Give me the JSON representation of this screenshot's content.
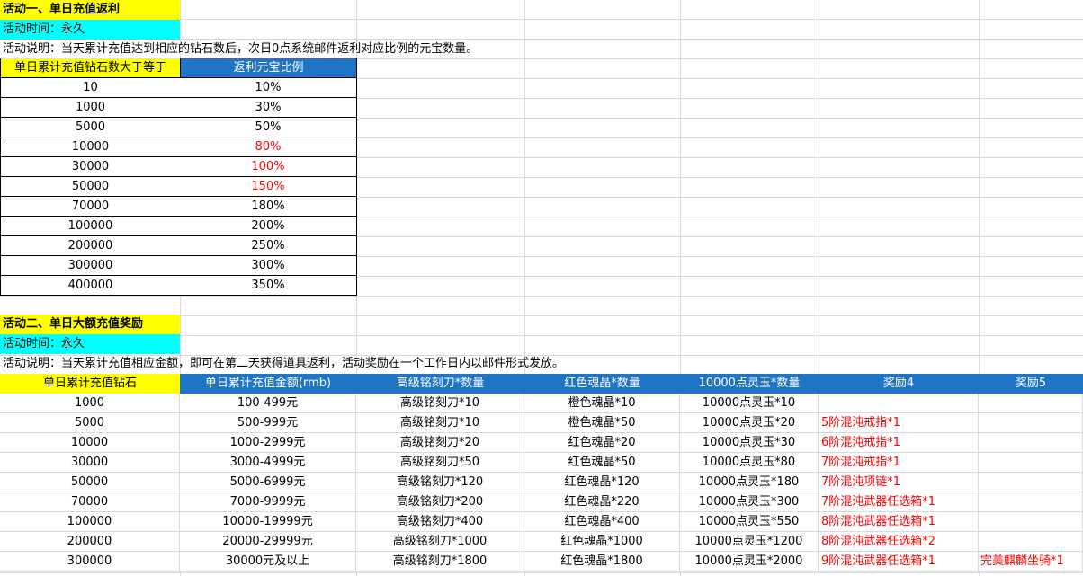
{
  "colors": {
    "title_bg": "#ffff00",
    "time_bg": "#00ffff",
    "header_bg": "#1f74c6",
    "accent_red": "#ff0000"
  },
  "activity1": {
    "title": "活动一、单日充值返利",
    "time": "活动时间：永久",
    "desc": "活动说明：当天累计充值达到相应的钻石数后，次日0点系统邮件返利对应比例的元宝数量。",
    "headers": [
      "单日累计充值钻石数大于等于",
      "返利元宝比例"
    ],
    "rows": [
      {
        "c0": "10",
        "c1": "10%"
      },
      {
        "c0": "1000",
        "c1": "30%"
      },
      {
        "c0": "5000",
        "c1": "50%"
      },
      {
        "c0": "10000",
        "c1": "80%"
      },
      {
        "c0": "30000",
        "c1": "100%"
      },
      {
        "c0": "50000",
        "c1": "150%"
      },
      {
        "c0": "70000",
        "c1": "180%"
      },
      {
        "c0": "100000",
        "c1": "200%"
      },
      {
        "c0": "200000",
        "c1": "250%"
      },
      {
        "c0": "300000",
        "c1": "300%"
      },
      {
        "c0": "400000",
        "c1": "350%"
      }
    ]
  },
  "activity2": {
    "title": "活动二、单日大额充值奖励",
    "time": "活动时间：永久",
    "desc": "活动说明：当天累计充值相应金额，即可在第二天获得道具返利，活动奖励在一个工作日内以邮件形式发放。",
    "headers": [
      "单日累计充值钻石",
      "单日累计充值金额(rmb)",
      "高级铭刻刀*数量",
      "红色魂晶*数量",
      "10000点灵玉*数量",
      "奖励4",
      "奖励5"
    ],
    "rows": [
      {
        "c0": "1000",
        "c1": "100-499元",
        "c2": "高级铭刻刀*10",
        "c3": "橙色魂晶*10",
        "c4": "10000点灵玉*10",
        "c5": "",
        "c6": ""
      },
      {
        "c0": "5000",
        "c1": "500-999元",
        "c2": "高级铭刻刀*10",
        "c3": "橙色魂晶*50",
        "c4": "10000点灵玉*20",
        "c5": "5阶混沌戒指*1",
        "c6": ""
      },
      {
        "c0": "10000",
        "c1": "1000-2999元",
        "c2": "高级铭刻刀*20",
        "c3": "红色魂晶*20",
        "c4": "10000点灵玉*30",
        "c5": "6阶混沌戒指*1",
        "c6": ""
      },
      {
        "c0": "30000",
        "c1": "3000-4999元",
        "c2": "高级铭刻刀*50",
        "c3": "红色魂晶*50",
        "c4": "10000点灵玉*80",
        "c5": "7阶混沌戒指*1",
        "c6": ""
      },
      {
        "c0": "50000",
        "c1": "5000-6999元",
        "c2": "高级铭刻刀*120",
        "c3": "红色魂晶*120",
        "c4": "10000点灵玉*180",
        "c5": "7阶混沌项链*1",
        "c6": ""
      },
      {
        "c0": "70000",
        "c1": "7000-9999元",
        "c2": "高级铭刻刀*200",
        "c3": "红色魂晶*220",
        "c4": "10000点灵玉*300",
        "c5": "7阶混沌武器任选箱*1",
        "c6": ""
      },
      {
        "c0": "100000",
        "c1": "10000-19999元",
        "c2": "高级铭刻刀*400",
        "c3": "红色魂晶*400",
        "c4": "10000点灵玉*550",
        "c5": "8阶混沌武器任选箱*1",
        "c6": ""
      },
      {
        "c0": "200000",
        "c1": "20000-29999元",
        "c2": "高级铭刻刀*1000",
        "c3": "红色魂晶*1000",
        "c4": "10000点灵玉*1200",
        "c5": "8阶混沌武器任选箱*2",
        "c6": ""
      },
      {
        "c0": "300000",
        "c1": "30000元及以上",
        "c2": "高级铭刻刀*1800",
        "c3": "红色魂晶*1800",
        "c4": "10000点灵玉*2000",
        "c5": "9阶混沌武器任选箱*1",
        "c6": "完美麒麟坐骑*1"
      }
    ]
  }
}
